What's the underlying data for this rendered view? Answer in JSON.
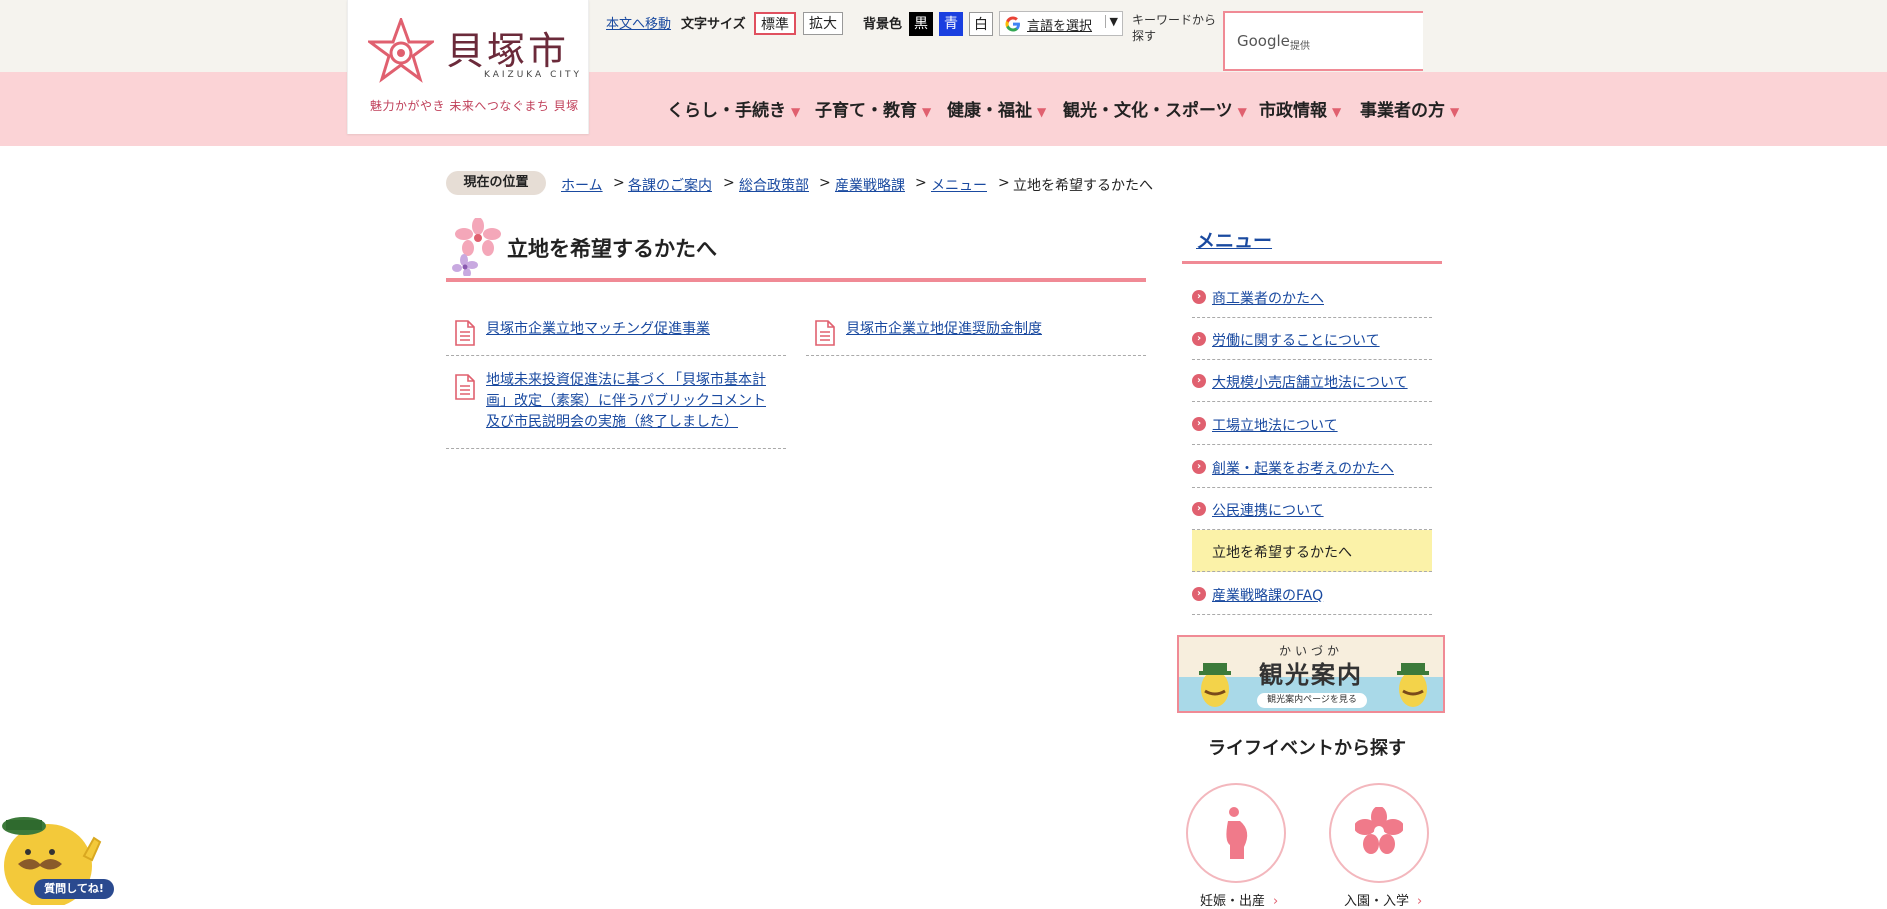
{
  "header": {
    "logo_kanji": "貝塚市",
    "logo_roman": "KAIZUKA CITY",
    "logo_tagline": "魅力かがやき 未来へつなぐまち 貝塚",
    "skip_link": "本文へ移動",
    "font_size_label": "文字サイズ",
    "font_size_standard": "標準",
    "font_size_large": "拡大",
    "bg_color_label": "背景色",
    "bg_black": "黒",
    "bg_blue": "青",
    "bg_white": "白",
    "language_select": "言語を選択",
    "keyword_label": "キーワードから探す",
    "search_brand": "Google",
    "search_provided": "提供"
  },
  "nav": {
    "items": [
      {
        "label": "くらし・手続き"
      },
      {
        "label": "子育て・教育"
      },
      {
        "label": "健康・福祉"
      },
      {
        "label": "観光・文化・スポーツ"
      },
      {
        "label": "市政情報"
      },
      {
        "label": "事業者の方"
      }
    ]
  },
  "breadcrumb": {
    "label": "現在の位置",
    "items": [
      "ホーム",
      "各課のご案内",
      "総合政策部",
      "産業戦略課",
      "メニュー"
    ],
    "current": "立地を希望するかたへ"
  },
  "main": {
    "title": "立地を希望するかたへ",
    "links": [
      "貝塚市企業立地マッチング促進事業",
      "貝塚市企業立地促進奨励金制度",
      "地域未来投資促進法に基づく「貝塚市基本計画」改定（素案）に伴うパブリックコメント及び市民説明会の実施（終了しました）"
    ]
  },
  "sidebar": {
    "menu_title": "メニュー",
    "items": [
      {
        "label": "商工業者のかたへ",
        "current": false
      },
      {
        "label": "労働に関することについて",
        "current": false
      },
      {
        "label": "大規模小売店舗立地法について",
        "current": false
      },
      {
        "label": "工場立地法について",
        "current": false
      },
      {
        "label": "創業・起業をお考えのかたへ",
        "current": false
      },
      {
        "label": "公民連携について",
        "current": false
      },
      {
        "label": "立地を希望するかたへ",
        "current": true
      },
      {
        "label": "産業戦略課のFAQ",
        "current": false
      }
    ],
    "banner_sub": "かいづか",
    "banner_title": "観光案内",
    "banner_link": "観光案内ページを見る",
    "life_event_title": "ライフイベントから探す",
    "life_events": [
      "妊娠・出産",
      "入園・入学"
    ]
  },
  "chatbot": {
    "label": "質問してね!"
  },
  "colors": {
    "accent": "#f08a95",
    "nav_band": "#fbd3d6",
    "top_strip": "#f5f3ee",
    "link": "#1a4aa0",
    "current_bg": "#fbf2a8"
  }
}
